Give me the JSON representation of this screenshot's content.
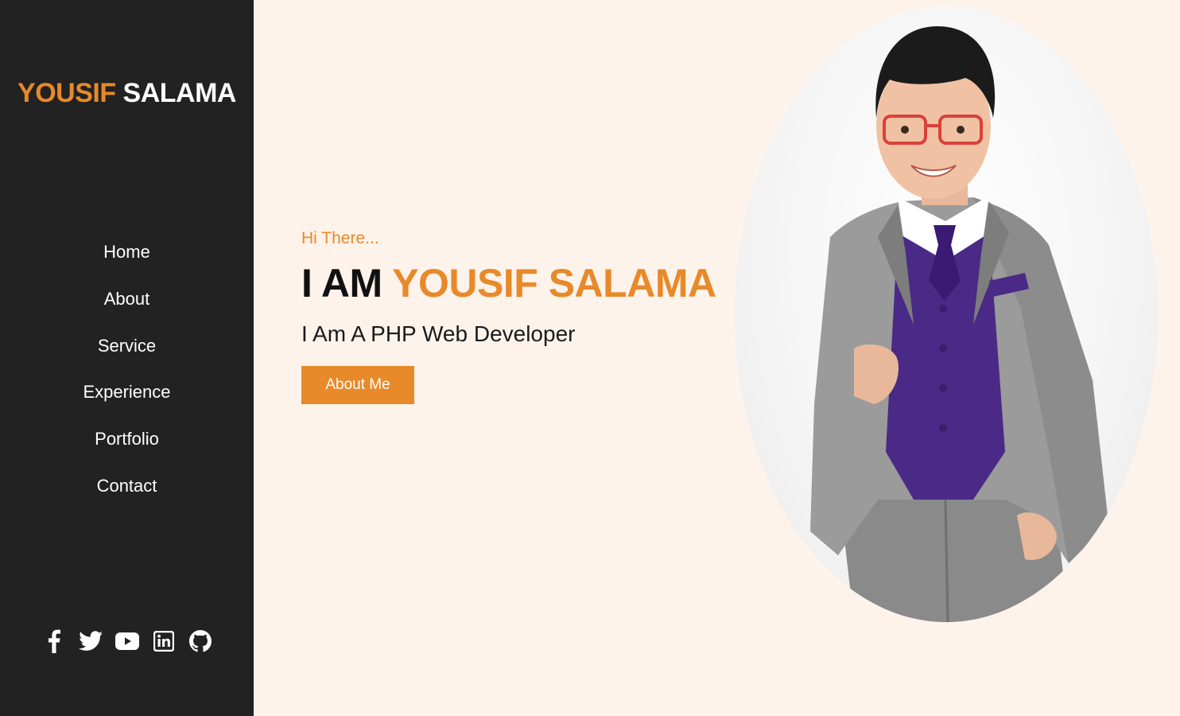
{
  "sidebar": {
    "logo_first": "YOUSIF",
    "logo_second": "SALAMA",
    "nav": [
      {
        "label": "Home"
      },
      {
        "label": "About"
      },
      {
        "label": "Service"
      },
      {
        "label": "Experience"
      },
      {
        "label": "Portfolio"
      },
      {
        "label": "Contact"
      }
    ],
    "social": [
      "facebook-icon",
      "twitter-icon",
      "youtube-icon",
      "linkedin-icon",
      "github-icon"
    ]
  },
  "hero": {
    "greeting": "Hi There...",
    "headline_prefix": "I AM",
    "headline_name": "YOUSIF SALAMA",
    "subtitle": "I Am A PHP Web Developer",
    "button_label": "About Me"
  },
  "colors": {
    "accent": "#e8892a",
    "sidebar_bg": "#222222",
    "page_bg": "#fdf3ea"
  }
}
